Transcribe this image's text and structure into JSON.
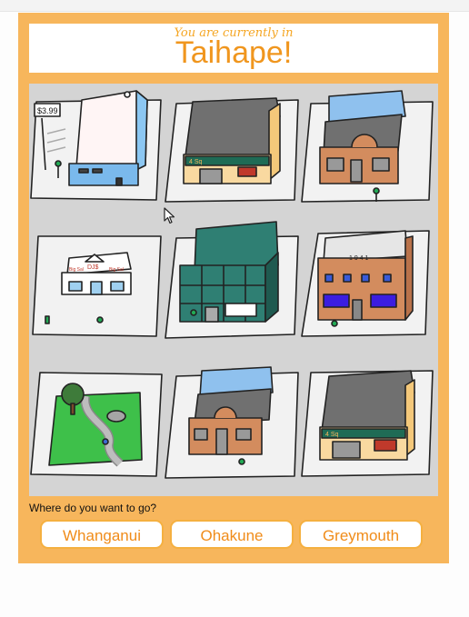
{
  "header": {
    "subtitle": "You are currently in",
    "town": "Taihape!"
  },
  "map": {
    "price_sign": "$3.99",
    "shop_sign_left": "Big Sal",
    "shop_sign_logo": "DJ$",
    "shop_sign_right": "Big Sal",
    "shop_year": "1 9 4 1",
    "four_square_top": "4 Sq",
    "four_square_bottom": "4 Sq"
  },
  "prompt": {
    "question": "Where do you want to go?"
  },
  "destinations": [
    "Whanganui",
    "Ohakune",
    "Greymouth"
  ],
  "colors": {
    "panel": "#f7b65c",
    "accent_text": "#f0961e",
    "button_border": "#f5b040",
    "map_background": "#d4d4d4"
  }
}
